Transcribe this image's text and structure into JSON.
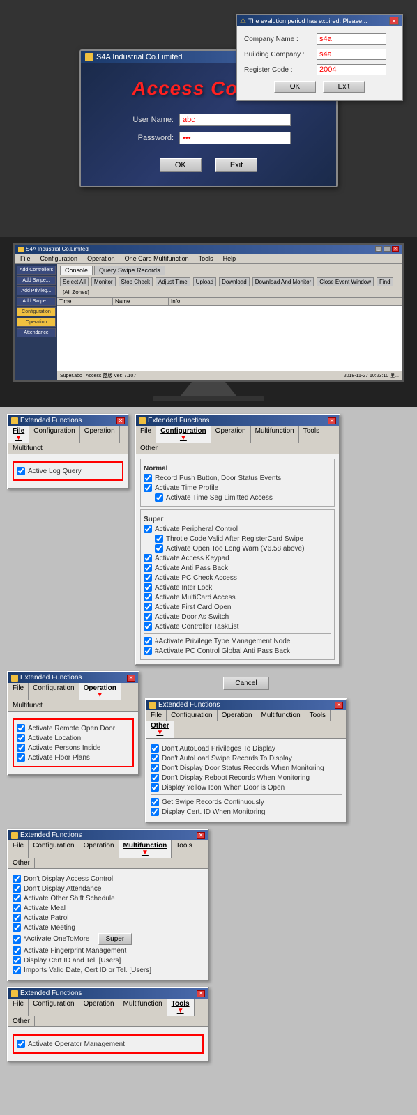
{
  "login_window": {
    "title": "S4A Industrial Co.Limited",
    "access_control_title": "Access Control",
    "username_label": "User Name:",
    "password_label": "Password:",
    "username_value": "abc",
    "password_value": "123",
    "ok_btn": "OK",
    "exit_btn": "Exit"
  },
  "eval_popup": {
    "title": "The evalution period has expired.  Please...",
    "company_name_label": "Company Name :",
    "building_company_label": "Building Company :",
    "register_code_label": "Register Code :",
    "company_name_value": "s4a",
    "building_company_value": "s4a",
    "register_code_value": "2004",
    "ok_btn": "OK",
    "exit_btn": "Exit"
  },
  "monitor": {
    "app_title": "S4A Industrial Co.Limited",
    "tabs": [
      "Console",
      "Query Swipe Records"
    ],
    "menu_items": [
      "File",
      "Configuration",
      "Operation",
      "One Card Multifunction",
      "Tools",
      "Help"
    ],
    "toolbar_items": [
      "Select All",
      "Monitor",
      "Stop Check",
      "Adjust Time",
      "Upload",
      "Download",
      "Download And Monitor",
      "Close Event Window",
      "Find"
    ],
    "sidebar_items": [
      "Add Controllers",
      "Add Swipe...",
      "Add Privileg...",
      "Add Swipe...",
      "Configuration",
      "Operation",
      "Attendance"
    ],
    "table_headers": [
      "Time",
      "Name",
      "Info"
    ]
  },
  "panels": {
    "window_title": "Extended Functions",
    "win_icon": "★",
    "close_x": "✕",
    "tabs": {
      "file": "File",
      "configuration": "Configuration",
      "operation": "Operation",
      "multifunction": "Multifunction",
      "tools": "Tools",
      "other": "Other"
    },
    "panel1_file": {
      "active_tab": "File",
      "items": [
        {
          "label": "Active Log Query",
          "checked": true
        }
      ]
    },
    "panel2_config": {
      "active_tab": "Configuration",
      "normal_label": "Normal",
      "super_label": "Super",
      "normal_items": [
        {
          "label": "Record Push Button, Door Status Events",
          "checked": true,
          "indent": false
        },
        {
          "label": "Activate Time Profile",
          "checked": true,
          "indent": false
        },
        {
          "label": "Activate Time Seg Limitted Access",
          "checked": true,
          "indent": true
        }
      ],
      "super_items": [
        {
          "label": "Activate Peripheral Control",
          "checked": true,
          "indent": false
        },
        {
          "label": "Throtle Code Valid After RegisterCard Swipe",
          "checked": true,
          "indent": true
        },
        {
          "label": "Activate Open Too Long Warn (V6.58 above)",
          "checked": true,
          "indent": true
        },
        {
          "label": "Activate Access Keypad",
          "checked": true,
          "indent": false
        },
        {
          "label": "Activate Anti Pass Back",
          "checked": true,
          "indent": false
        },
        {
          "label": "Activate PC Check Access",
          "checked": true,
          "indent": false
        },
        {
          "label": "Activate Inter Lock",
          "checked": true,
          "indent": false
        },
        {
          "label": "Activate MultiCard Access",
          "checked": true,
          "indent": false
        },
        {
          "label": "Activate First Card Open",
          "checked": true,
          "indent": false
        },
        {
          "label": "Activate Door As Switch",
          "checked": true,
          "indent": false
        },
        {
          "label": "Activate Controller TaskList",
          "checked": true,
          "indent": false
        },
        {
          "label": "#Activate Privilege Type Management Node",
          "checked": true,
          "indent": false
        },
        {
          "label": "#Activate PC Control Global Anti Pass Back",
          "checked": true,
          "indent": false
        }
      ],
      "cancel_btn": "Cancel"
    },
    "panel3_operation": {
      "active_tab": "Operation",
      "items": [
        {
          "label": "Activate Remote Open Door",
          "checked": true
        },
        {
          "label": "Activate Location",
          "checked": true
        },
        {
          "label": "Activate Persons Inside",
          "checked": true
        },
        {
          "label": "Activate Floor Plans",
          "checked": true
        }
      ]
    },
    "panel4_multifunction": {
      "active_tab": "Multifunction",
      "items": [
        {
          "label": "Don't Display Access Control",
          "checked": true
        },
        {
          "label": "Don't Display Attendance",
          "checked": true
        },
        {
          "label": "Activate Other Shift Schedule",
          "checked": true
        },
        {
          "label": "Activate Meal",
          "checked": true
        },
        {
          "label": "Activate Patrol",
          "checked": true
        },
        {
          "label": "Activate Meeting",
          "checked": true
        },
        {
          "label": "*Activate OneToMore",
          "checked": true
        },
        {
          "label": "Activate Fingerprint Management",
          "checked": true
        },
        {
          "label": "Display Cert ID and Tel. [Users]",
          "checked": true
        },
        {
          "label": "Imports Valid Date, Cert ID or Tel. [Users]",
          "checked": true
        }
      ],
      "super_btn": "Super"
    },
    "panel5_other": {
      "active_tab": "Other",
      "items": [
        {
          "label": "Don't AutoLoad Privileges To Display",
          "checked": true
        },
        {
          "label": "Don't AutoLoad Swipe Records To Display",
          "checked": true
        },
        {
          "label": "Don't Display Door Status Records When Monitoring",
          "checked": true
        },
        {
          "label": "Don't Display Reboot Records When Monitoring",
          "checked": true
        },
        {
          "label": "Display Yellow Icon When Door is Open",
          "checked": true
        },
        {
          "label": "Get Swipe Records Continuously",
          "checked": true
        },
        {
          "label": "Display Cert. ID When Monitoring",
          "checked": true
        }
      ]
    },
    "panel6_tools": {
      "active_tab": "Tools",
      "items": [
        {
          "label": "Activate Operator Management",
          "checked": true
        }
      ]
    }
  }
}
